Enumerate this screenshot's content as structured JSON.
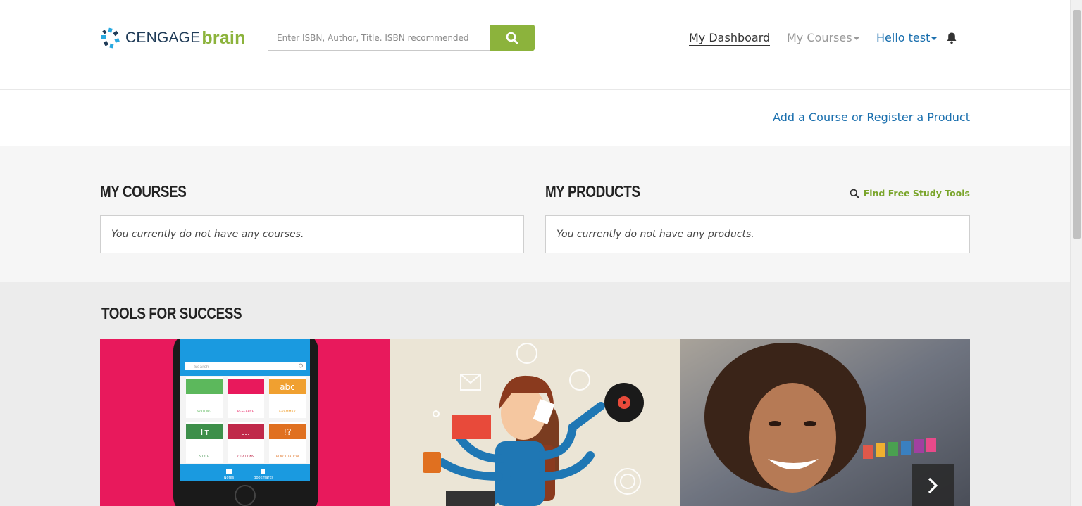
{
  "header": {
    "logo": {
      "cengage": "CENGAGE",
      "brain": "brain"
    },
    "search": {
      "placeholder": "Enter ISBN, Author, Title. ISBN recommended"
    },
    "nav": {
      "dashboard": "My Dashboard",
      "courses": "My Courses",
      "hello": "Hello test"
    }
  },
  "add_bar": {
    "link": "Add a Course or Register a Product"
  },
  "courses": {
    "title": "MY COURSES",
    "empty": "You currently do not have any courses."
  },
  "products": {
    "title": "MY PRODUCTS",
    "find_tools": "Find Free Study Tools",
    "empty": "You currently do not have any products."
  },
  "tools": {
    "title": "TOOLS FOR SUCCESS",
    "card1": {
      "search_placeholder": "Search",
      "tiles": [
        {
          "label": "WRITING",
          "color": "#5cb85c"
        },
        {
          "label": "RESEARCH",
          "color": "#e8195c"
        },
        {
          "label": "GRAMMAR",
          "color": "#f0a030"
        },
        {
          "label": "STYLE",
          "color": "#3d8f4a"
        },
        {
          "label": "CITATIONS",
          "color": "#c0294a"
        },
        {
          "label": "PUNCTUATION",
          "color": "#e07020"
        }
      ],
      "tile_glyphs": [
        "",
        "",
        "abc",
        "Tт",
        "…",
        "!?"
      ],
      "bottom": [
        "Notes",
        "Bookmarks"
      ]
    }
  },
  "colors": {
    "brand_green": "#8cb33c",
    "link_blue": "#1a6fae",
    "card1_bg": "#e8195c"
  }
}
